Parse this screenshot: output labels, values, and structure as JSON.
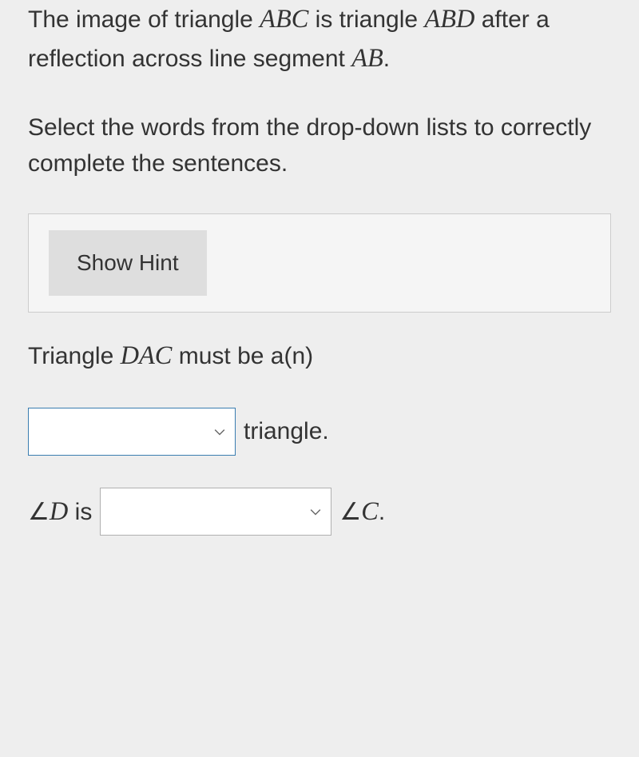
{
  "problem": {
    "line1_pre": "The image of triangle ",
    "line1_tri1": "ABC",
    "line1_mid": " is triangle ",
    "line1_tri2": "ABD",
    "line1_after": " after a reflection across line segment ",
    "line1_seg": "AB",
    "line1_end": "."
  },
  "instruction": "Select the words from the drop-down lists to correctly complete the sentences.",
  "hint_label": "Show Hint",
  "sentence1": {
    "pre": "Triangle ",
    "tri": "DAC",
    "post": " must be a(n)"
  },
  "sentence1b_post": "triangle.",
  "sentence2": {
    "angle_pre": "∠",
    "d": "D",
    "is": " is",
    "c": "C",
    "dot": "."
  }
}
